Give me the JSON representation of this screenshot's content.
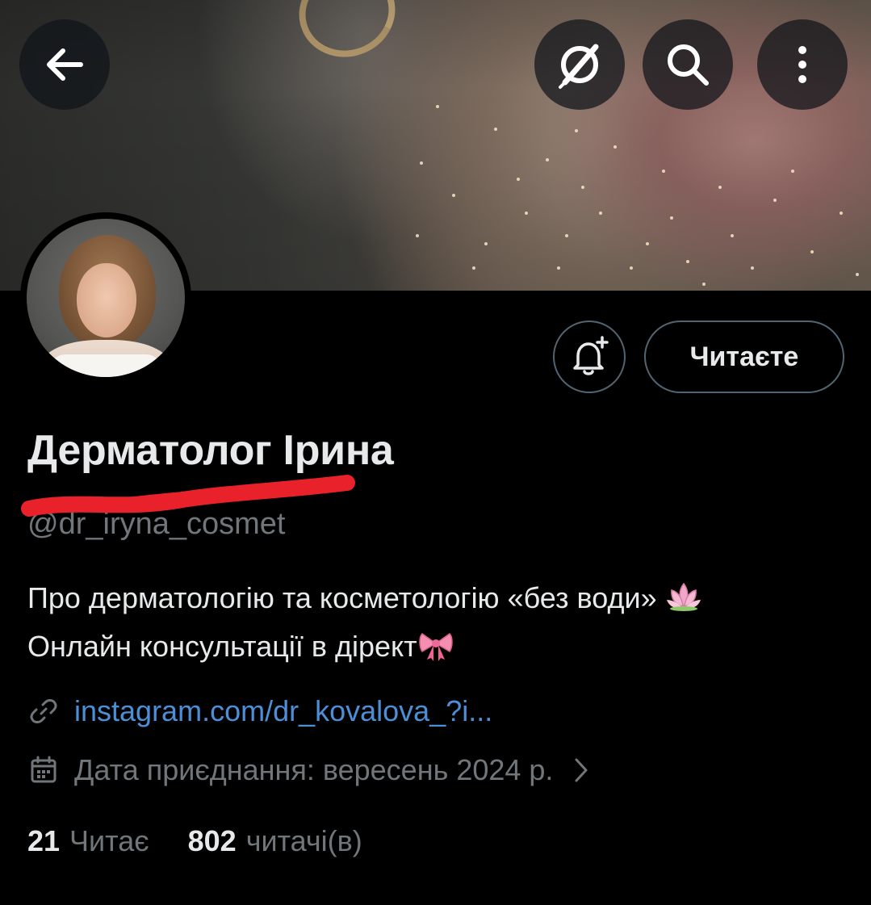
{
  "header": {
    "back_icon": "arrow-left-icon",
    "grok_icon": "grok-icon",
    "search_icon": "search-icon",
    "more_icon": "more-vertical-icon"
  },
  "profile": {
    "display_name": "Дерматолог Ірина",
    "handle": "@dr_iryna_cosmet",
    "bio_line1": "Про дерматологію та косметологію «без води»",
    "bio_line1_emoji": "🪷",
    "bio_line2": "Онлайн консультації в дірект",
    "bio_line2_emoji": "🎀",
    "link": "instagram.com/dr_kovalova_?i...",
    "joined": "Дата приєднання: вересень 2024 р."
  },
  "actions": {
    "notify_icon": "bell-plus-icon",
    "follow_label": "Читаєте"
  },
  "stats": {
    "following_count": "21",
    "following_label": "Читає",
    "followers_count": "802",
    "followers_label": "читачі(в)"
  },
  "colors": {
    "background": "#000000",
    "text_primary": "#e7e9ea",
    "text_secondary": "#71767b",
    "link": "#4c8fd6",
    "border": "#536471",
    "redaction": "#e8212a"
  }
}
